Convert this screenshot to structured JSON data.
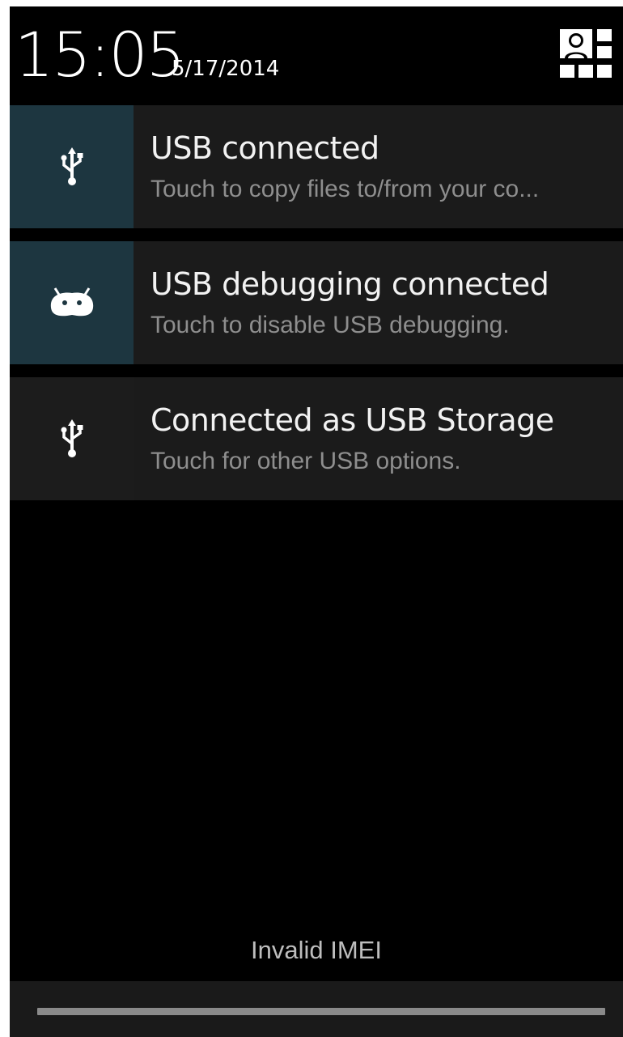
{
  "header": {
    "time": "15:05",
    "date": "5/17/2014",
    "settings_icon": "quick-settings-icon"
  },
  "notifications": [
    {
      "icon": "usb-icon",
      "title": "USB connected",
      "subtitle": "Touch to copy files to/from your co..."
    },
    {
      "icon": "android-debug-icon",
      "title": "USB debugging connected",
      "subtitle": "Touch to disable USB debugging."
    },
    {
      "icon": "usb-icon",
      "title": "Connected as USB Storage",
      "subtitle": "Touch for other USB options."
    }
  ],
  "carrier_label": "Invalid IMEI",
  "colors": {
    "icon_bg_highlight": "#1d3640",
    "notification_bg": "#1b1b1b",
    "subtitle_text": "#8e8e8e"
  }
}
